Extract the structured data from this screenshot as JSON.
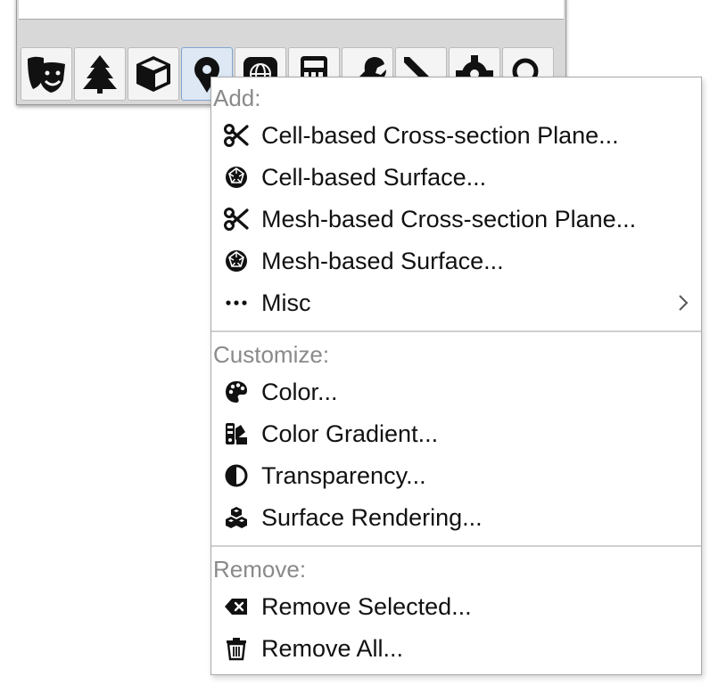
{
  "menu": {
    "sections": [
      {
        "label": "Add:",
        "items": [
          {
            "label": "Cell-based Cross-section Plane...",
            "icon": "scissors-icon"
          },
          {
            "label": "Cell-based Surface...",
            "icon": "icosahedron-icon"
          },
          {
            "label": "Mesh-based Cross-section Plane...",
            "icon": "scissors-icon"
          },
          {
            "label": "Mesh-based Surface...",
            "icon": "icosahedron-icon"
          },
          {
            "label": "Misc",
            "icon": "ellipsis-icon",
            "submenu": true
          }
        ]
      },
      {
        "label": "Customize:",
        "items": [
          {
            "label": "Color...",
            "icon": "palette-icon"
          },
          {
            "label": "Color Gradient...",
            "icon": "swatchbook-icon"
          },
          {
            "label": "Transparency...",
            "icon": "half-circle-icon"
          },
          {
            "label": "Surface Rendering...",
            "icon": "cubes-icon"
          }
        ]
      },
      {
        "label": "Remove:",
        "items": [
          {
            "label": "Remove Selected...",
            "icon": "backspace-icon"
          },
          {
            "label": "Remove All...",
            "icon": "trash-icon"
          }
        ]
      }
    ]
  },
  "toolbar": {
    "buttons": [
      {
        "icon": "theater-masks-icon"
      },
      {
        "icon": "tree-icon"
      },
      {
        "icon": "cube-icon"
      },
      {
        "icon": "map-pin-icon",
        "active": true
      },
      {
        "icon": "globe-icon"
      },
      {
        "icon": "calculator-icon"
      },
      {
        "icon": "wrench-icon"
      },
      {
        "icon": "pencil-icon"
      },
      {
        "icon": "gear-icon"
      },
      {
        "icon": "search-icon"
      }
    ]
  },
  "colors": {
    "section_label": "#8a8a8a",
    "item_text": "#111111",
    "active_button": "#dde8f4"
  }
}
